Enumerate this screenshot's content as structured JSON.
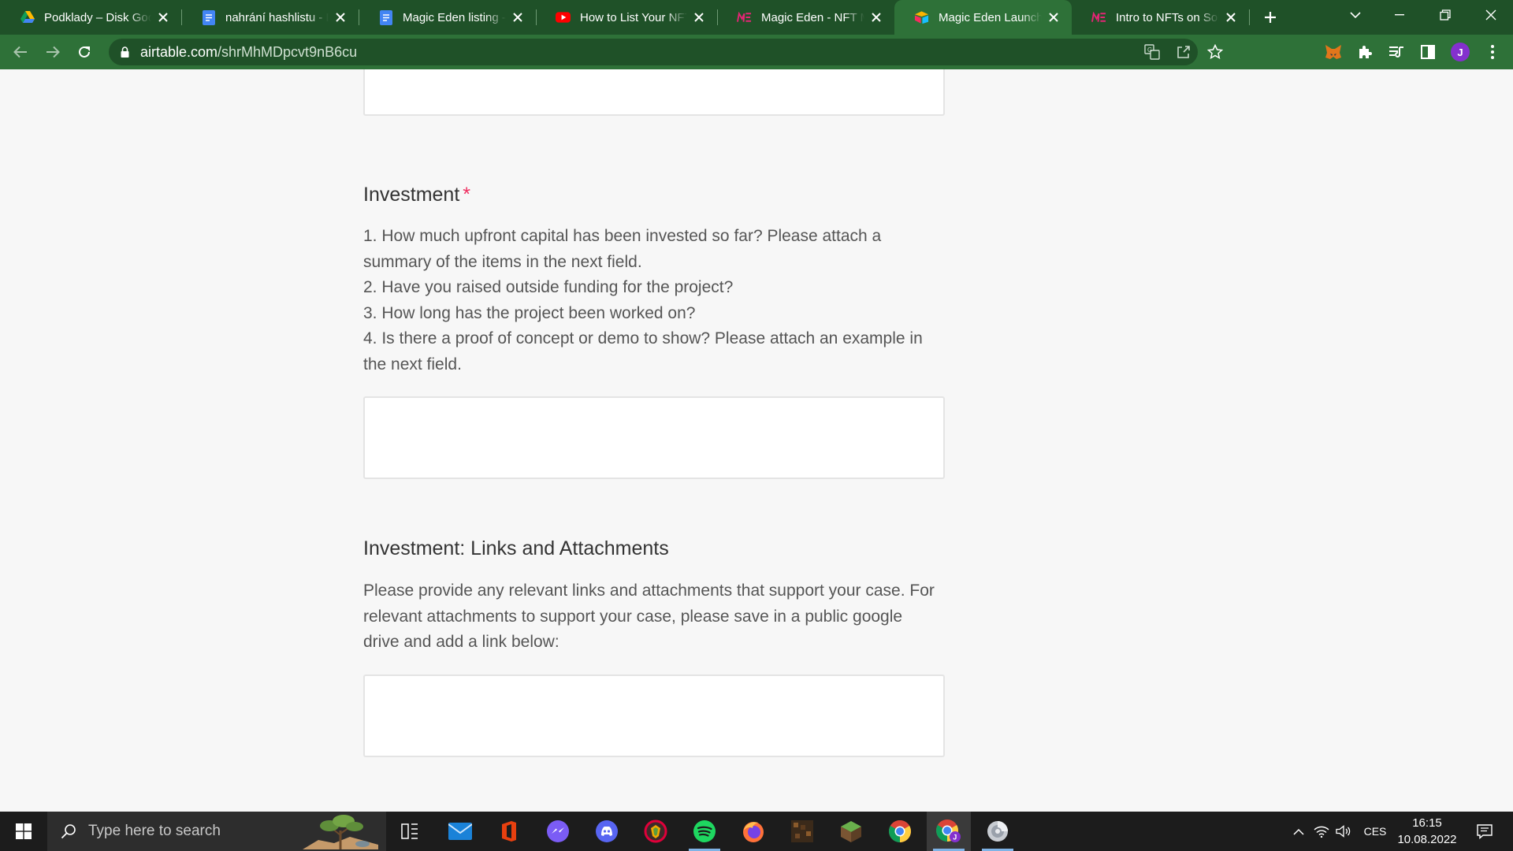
{
  "browser": {
    "tabs": [
      {
        "title": "Podklady – Disk Google",
        "favicon": "google-drive-icon",
        "active": false
      },
      {
        "title": "nahrání hashlistu - Dokumenty Google",
        "favicon": "google-docs-icon",
        "active": false
      },
      {
        "title": "Magic Eden listing - Dokumenty Google",
        "favicon": "google-docs-icon",
        "active": false
      },
      {
        "title": "How to List Your NFT",
        "favicon": "youtube-icon",
        "active": false
      },
      {
        "title": "Magic Eden - NFT Marketplace",
        "favicon": "magic-eden-icon",
        "active": false
      },
      {
        "title": "Magic Eden Launchpad",
        "favicon": "airtable-icon",
        "active": true
      },
      {
        "title": "Intro to NFTs on Solana",
        "favicon": "magic-eden-icon",
        "active": false
      }
    ],
    "url_host": "airtable.com",
    "url_path": "/shrMhMDpcvt9nB6cu",
    "profile_initial": "J"
  },
  "form": {
    "investment": {
      "title": "Investment",
      "required_mark": "*",
      "description_lines": [
        "1. How much upfront capital has been invested so far? Please attach a",
        "summary of the items in the next field.",
        "2. Have you raised outside funding for the project?",
        "3. How long has the project been worked on?",
        "4. Is there a proof of concept or demo to show? Please attach an example in",
        "the next field."
      ]
    },
    "links": {
      "title": "Investment: Links and Attachments",
      "description_lines": [
        "Please provide any relevant links and attachments that support your case. For",
        "relevant attachments to support your case, please save in a public google",
        "drive and add a link below:"
      ]
    }
  },
  "taskbar": {
    "search_placeholder": "Type here to search",
    "apps": [
      "task-view-icon",
      "mail-icon",
      "office-icon",
      "messenger-icon",
      "discord-icon",
      "brave-icon",
      "spotify-icon",
      "firefox-icon",
      "minecraft-icon",
      "minecraft-launcher-icon",
      "chrome-icon",
      "chrome-profile-icon",
      "settings-disc-icon"
    ],
    "language": "CES",
    "time": "16:15",
    "date": "10.08.2022"
  },
  "colors": {
    "chrome_frame": "#1f5128",
    "chrome_toolbar": "#2e7138",
    "page_background": "#f7f7f7",
    "required_asterisk": "#ef3061",
    "taskbar": "#1c1c1c"
  }
}
